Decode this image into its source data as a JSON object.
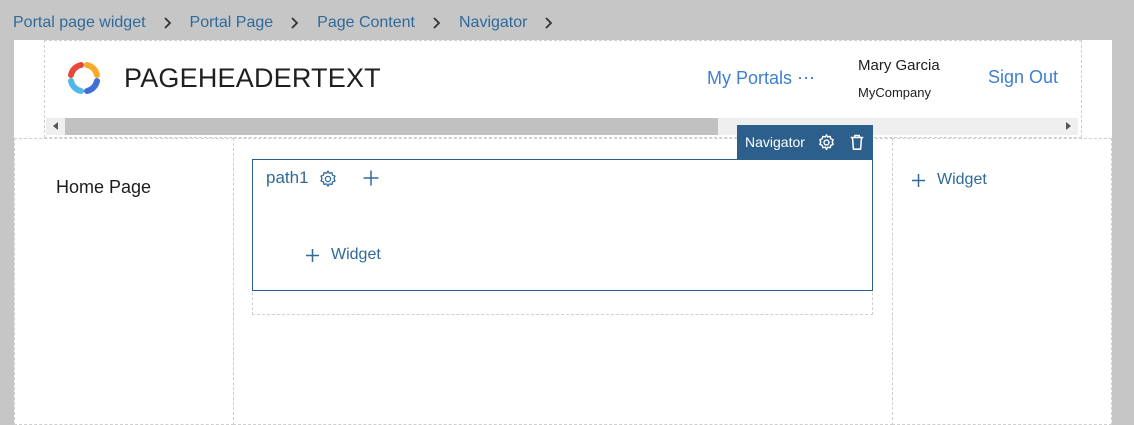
{
  "breadcrumb": [
    "Portal page widget",
    "Portal Page",
    "Page Content",
    "Navigator"
  ],
  "header": {
    "title": "PAGEHEADERTEXT",
    "my_portals": "My Portals ⋯",
    "user_name": "Mary Garcia",
    "company": "MyCompany",
    "sign_out": "Sign Out"
  },
  "sidebar": {
    "home": "Home Page"
  },
  "navigator": {
    "toolbar_label": "Navigator",
    "path_label": "path1",
    "widget_label": "Widget"
  },
  "right_column": {
    "widget_label": "Widget"
  },
  "colors": {
    "accent": "#2c5f8c",
    "link": "#3d7fd0",
    "breadcrumb": "#2f6a9a",
    "background": "#c6c6c6"
  },
  "icons": [
    "chevron-right-icon",
    "company-logo",
    "gear-icon",
    "trash-icon",
    "plus-icon",
    "scroll-arrow-left",
    "scroll-arrow-right"
  ]
}
